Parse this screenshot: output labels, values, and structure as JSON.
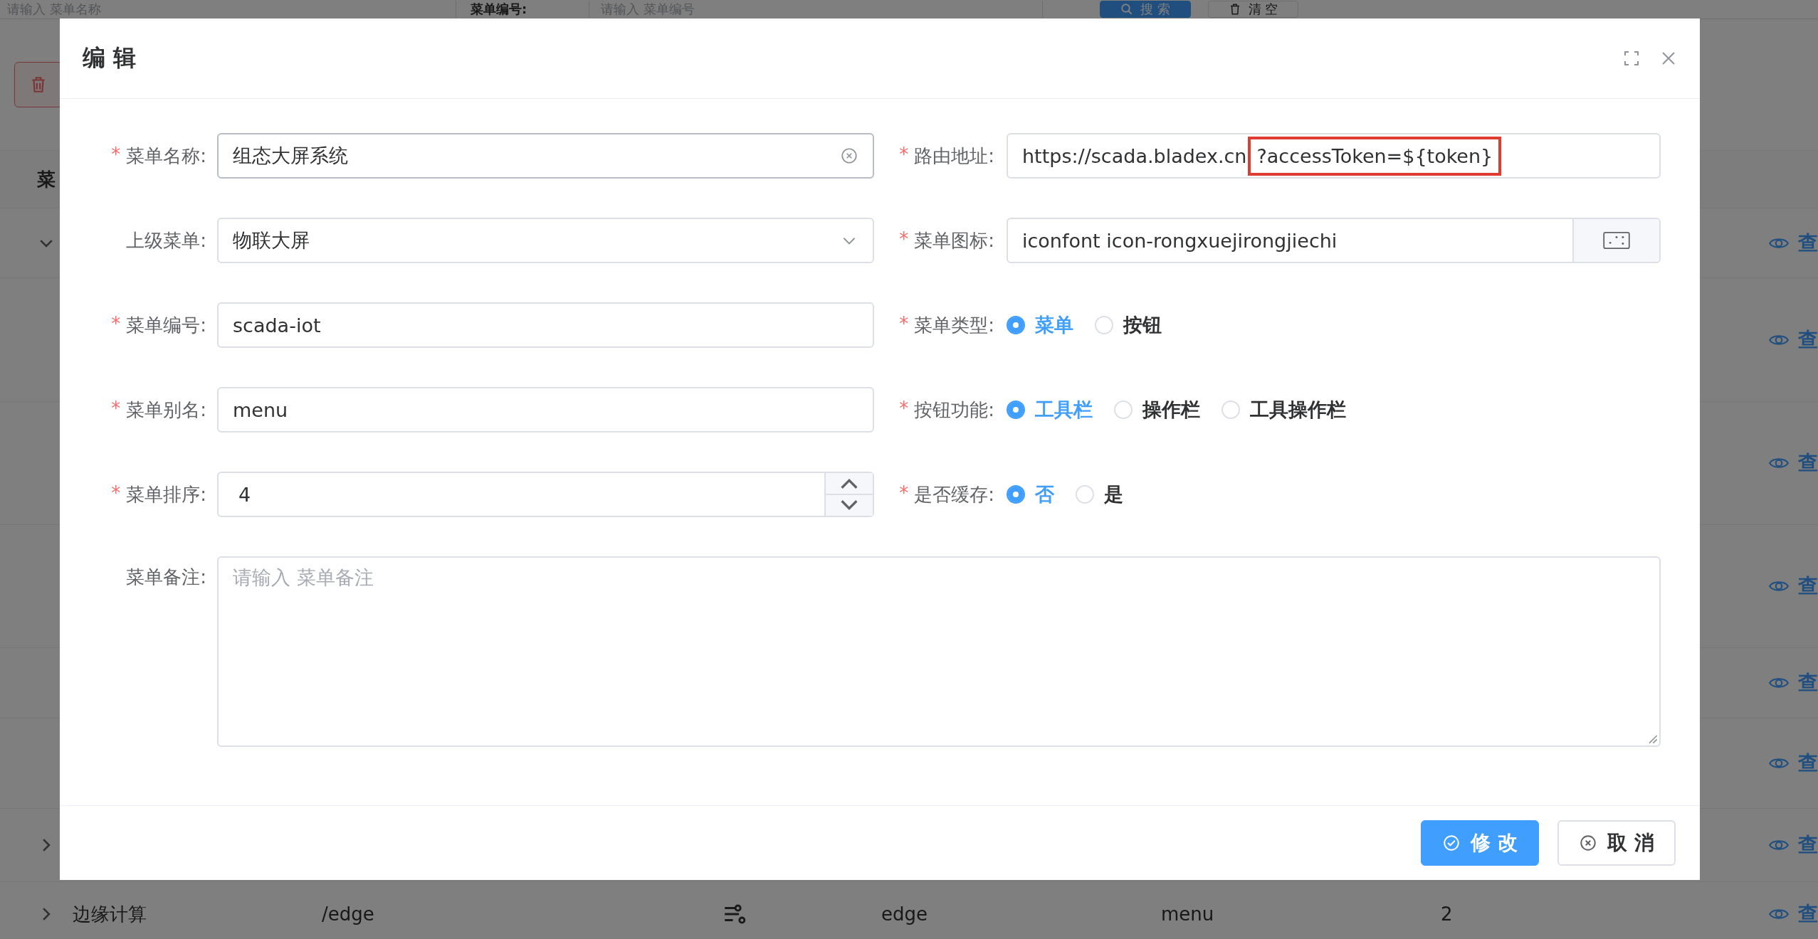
{
  "background": {
    "search_bar": {
      "name_placeholder": "请输入 菜单名称",
      "code_label": "菜单编号:",
      "code_placeholder": "请输入 菜单编号",
      "search_button": "搜 索",
      "clear_button": "清 空"
    },
    "table": {
      "header_first": "菜",
      "rows": [
        {
          "kind": "parent",
          "expanded": true,
          "action": "查"
        },
        {
          "kind": "child",
          "action": "查"
        },
        {
          "kind": "child",
          "action": "查"
        },
        {
          "kind": "child",
          "action": "查"
        },
        {
          "kind": "child",
          "action": "查"
        },
        {
          "kind": "child",
          "action": "查"
        },
        {
          "kind": "parent",
          "expanded": false,
          "action": "查"
        },
        {
          "kind": "parent",
          "expanded": false,
          "action": "查",
          "cells": [
            "边缘计算",
            "/edge",
            "edge",
            "menu",
            "2"
          ]
        }
      ]
    }
  },
  "dialog": {
    "title": "编 辑",
    "fields": [
      {
        "kind": "input",
        "label": "菜单名称:",
        "marker": "*",
        "value": "组态大屏系统",
        "clearable": true
      },
      {
        "kind": "input",
        "label": "路由地址:",
        "marker": "*",
        "value": "https://scada.bladex.cn",
        "highlighted": "?accessToken=${token}"
      },
      {
        "kind": "select",
        "label": "上级菜单:",
        "value": "物联大屏"
      },
      {
        "kind": "icon-picker",
        "label": "菜单图标:",
        "marker": "*",
        "value": "iconfont icon-rongxuejirongjiechi"
      },
      {
        "kind": "input",
        "label": "菜单编号:",
        "marker": "*",
        "value": "scada-iot"
      },
      {
        "kind": "radio",
        "label": "菜单类型:",
        "marker": "*",
        "options": [
          {
            "label": "菜单",
            "selected": true
          },
          {
            "label": "按钮",
            "selected": false
          }
        ]
      },
      {
        "kind": "input",
        "label": "菜单别名:",
        "marker": "*",
        "value": "menu"
      },
      {
        "kind": "radio",
        "label": "按钮功能:",
        "marker": "*",
        "options": [
          {
            "label": "工具栏",
            "selected": true
          },
          {
            "label": "操作栏",
            "selected": false
          },
          {
            "label": "工具操作栏",
            "selected": false
          }
        ]
      },
      {
        "kind": "number",
        "label": "菜单排序:",
        "marker": "*",
        "value": "4"
      },
      {
        "kind": "radio",
        "label": "是否缓存:",
        "marker": "*",
        "options": [
          {
            "label": "否",
            "selected": true
          },
          {
            "label": "是",
            "selected": false
          }
        ]
      },
      {
        "kind": "textarea",
        "label": "菜单备注:",
        "placeholder": "请输入 菜单备注"
      }
    ],
    "buttons": [
      {
        "label": "修 改",
        "kind": "primary"
      },
      {
        "label": "取 消",
        "kind": "default"
      }
    ]
  }
}
